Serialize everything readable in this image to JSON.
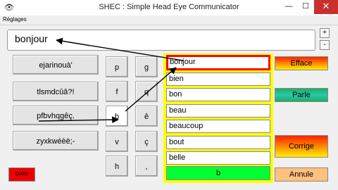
{
  "window": {
    "title": "SHEC : Simple Head Eye Communicator"
  },
  "menu": {
    "reglages": "Réglages"
  },
  "textbox": {
    "value": "bonjour"
  },
  "stepper": {
    "plus": "+",
    "minus": "-"
  },
  "groups": [
    "ejarinouà'",
    "tlsmdcûâ?!",
    "pfbvhqgêç.",
    "zyxkwéèë;-"
  ],
  "letters": {
    "col1": [
      "p",
      "f",
      "b",
      "v",
      "h"
    ],
    "col2": [
      "g",
      "q",
      "ê",
      "ç",
      ","
    ]
  },
  "words": [
    "bonjour",
    "bien",
    "bon",
    "beau",
    "beaucoup",
    "bout",
    "belle"
  ],
  "current_prefix": "b",
  "actions": {
    "efface": "Efface",
    "parle": "Parle",
    "corrige": "Corrige",
    "annule": "Annule"
  },
  "quitte": "Quitte",
  "colors": {
    "accent_red": "#ff0000",
    "panel_yellow": "#ffff00",
    "prefix_green": "#00ff33"
  }
}
